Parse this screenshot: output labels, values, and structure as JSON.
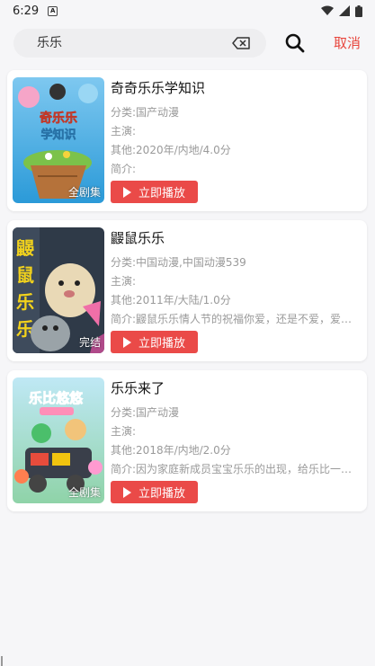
{
  "status": {
    "time": "6:29",
    "notif_letter": "A"
  },
  "search": {
    "query": "乐乐",
    "cancel_label": "取消"
  },
  "results": [
    {
      "title": "奇奇乐乐学知识",
      "category": "分类:国产动漫",
      "cast": "主演:",
      "other": "其他:2020年/内地/4.0分",
      "intro": "简介:",
      "badge": "全剧集",
      "play_label": "立即播放",
      "poster_text": "奇奇乐乐学知识"
    },
    {
      "title": "鼹鼠乐乐",
      "category": "分类:中国动漫,中国动漫539",
      "cast": "主演:",
      "other": "其他:2011年/大陆/1.0分",
      "intro": "简介:鼹鼠乐乐情人节的祝福你爱，还是不爱，爱都…",
      "badge": "完结",
      "play_label": "立即播放",
      "poster_text": "鼹鼠乐乐"
    },
    {
      "title": "乐乐来了",
      "category": "分类:国产动漫",
      "cast": "主演:",
      "other": "其他:2018年/内地/2.0分",
      "intro": "简介:因为家庭新成员宝宝乐乐的出现，给乐比一家…",
      "badge": "全剧集",
      "play_label": "立即播放",
      "poster_text": "乐比悠悠"
    }
  ],
  "colors": {
    "accent": "#ea4a48",
    "cancel": "#e8453c"
  }
}
